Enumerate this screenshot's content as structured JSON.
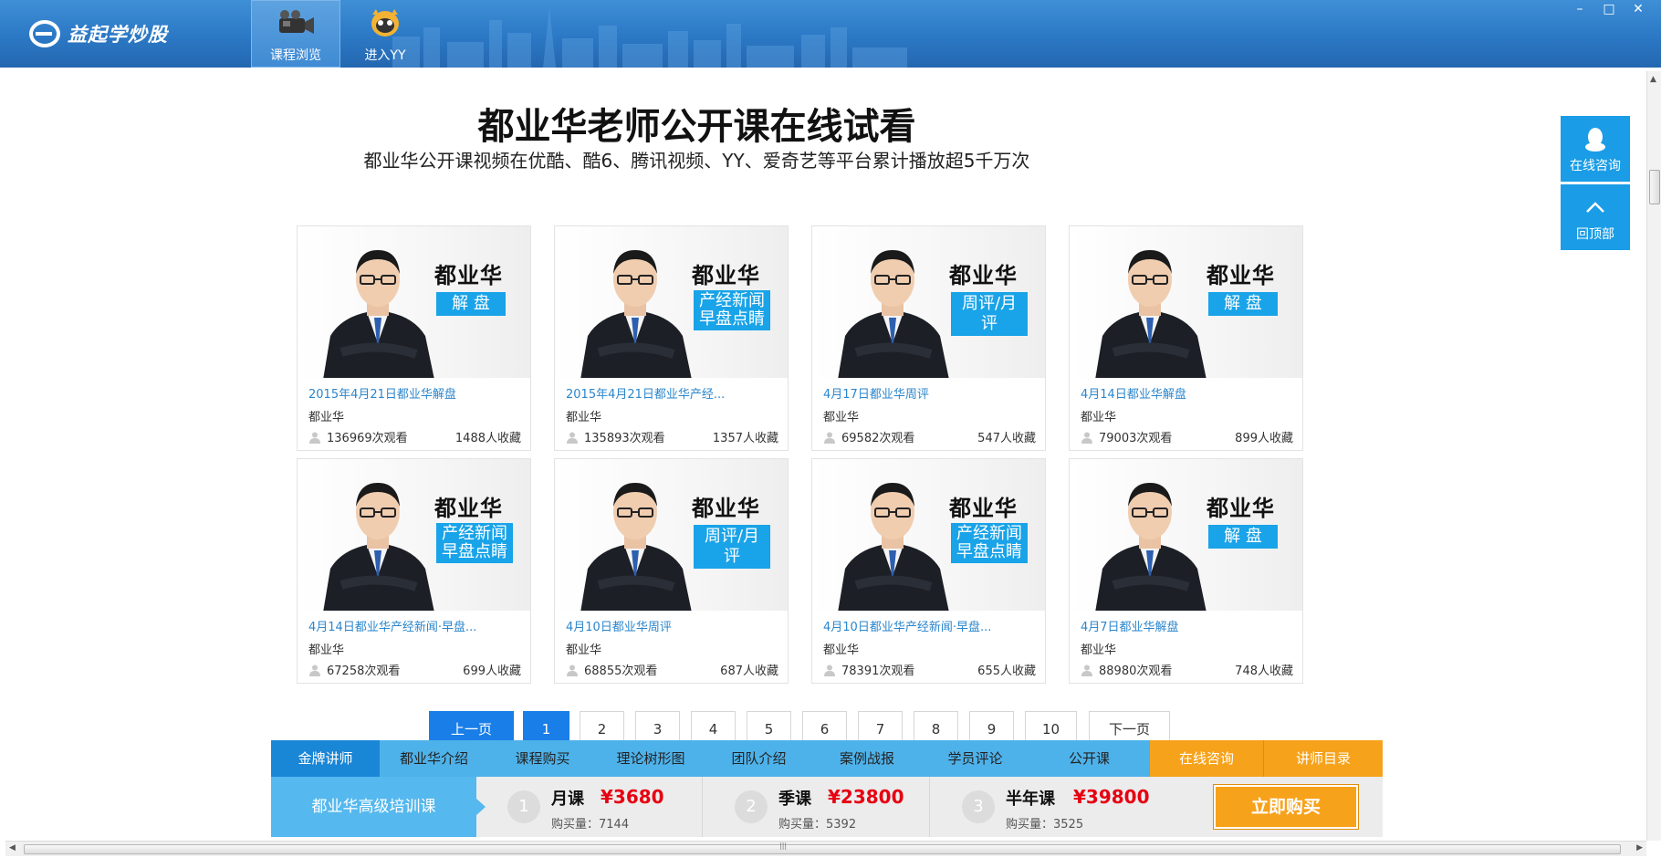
{
  "app": {
    "logo_text": "益起学炒股",
    "nav": [
      {
        "label": "课程浏览",
        "icon": "video-camera-icon"
      },
      {
        "label": "进入YY",
        "icon": "yy-mascot-icon"
      }
    ],
    "window_controls": {
      "minimize": "–",
      "maximize": "□",
      "close": "✕"
    }
  },
  "header": {
    "title": "都业华老师公开课在线试看",
    "subtitle": "都业华公开课视频在优酷、酷6、腾讯视频、YY、爱奇艺等平台累计播放超5千万次"
  },
  "float_buttons": {
    "consult": "在线咨询",
    "back_top": "回顶部"
  },
  "cards": [
    {
      "name": "都业华",
      "tag": "解 盘",
      "title": "2015年4月21日都业华解盘",
      "teacher": "都业华",
      "views": "136969次观看",
      "favs": "1488人收藏"
    },
    {
      "name": "都业华",
      "tag": "产经新闻\n早盘点睛",
      "title": "2015年4月21日都业华产经...",
      "teacher": "都业华",
      "views": "135893次观看",
      "favs": "1357人收藏"
    },
    {
      "name": "都业华",
      "tag": "周评/月评",
      "title": "4月17日都业华周评",
      "teacher": "都业华",
      "views": "69582次观看",
      "favs": "547人收藏"
    },
    {
      "name": "都业华",
      "tag": "解 盘",
      "title": "4月14日都业华解盘",
      "teacher": "都业华",
      "views": "79003次观看",
      "favs": "899人收藏"
    },
    {
      "name": "都业华",
      "tag": "产经新闻\n早盘点睛",
      "title": "4月14日都业华产经新闻·早盘...",
      "teacher": "都业华",
      "views": "67258次观看",
      "favs": "699人收藏"
    },
    {
      "name": "都业华",
      "tag": "周评/月评",
      "title": "4月10日都业华周评",
      "teacher": "都业华",
      "views": "68855次观看",
      "favs": "687人收藏"
    },
    {
      "name": "都业华",
      "tag": "产经新闻\n早盘点睛",
      "title": "4月10日都业华产经新闻·早盘...",
      "teacher": "都业华",
      "views": "78391次观看",
      "favs": "655人收藏"
    },
    {
      "name": "都业华",
      "tag": "解 盘",
      "title": "4月7日都业华解盘",
      "teacher": "都业华",
      "views": "88980次观看",
      "favs": "748人收藏"
    }
  ],
  "pagination": {
    "prev": "上一页",
    "pages": [
      "1",
      "2",
      "3",
      "4",
      "5",
      "6",
      "7",
      "8",
      "9",
      "10"
    ],
    "current": "1",
    "next": "下一页"
  },
  "bottom_tabs": [
    "金牌讲师",
    "都业华介绍",
    "课程购买",
    "理论树形图",
    "团队介绍",
    "案例战报",
    "学员评论",
    "公开课",
    "在线咨询",
    "讲师目录"
  ],
  "buy": {
    "course": "都业华高级培训课",
    "plans": [
      {
        "num": "1",
        "name": "月课",
        "price": "¥3680",
        "sold": "购买量：7144"
      },
      {
        "num": "2",
        "name": "季课",
        "price": "¥23800",
        "sold": "购买量：5392"
      },
      {
        "num": "3",
        "name": "半年课",
        "price": "¥39800",
        "sold": "购买量：3525"
      }
    ],
    "button": "立即购买"
  },
  "colors": {
    "accent": "#1a9de6",
    "titlebar": "#2b78c5",
    "orange": "#f7a21b",
    "price": "#e60012",
    "link": "#2b86cc"
  }
}
